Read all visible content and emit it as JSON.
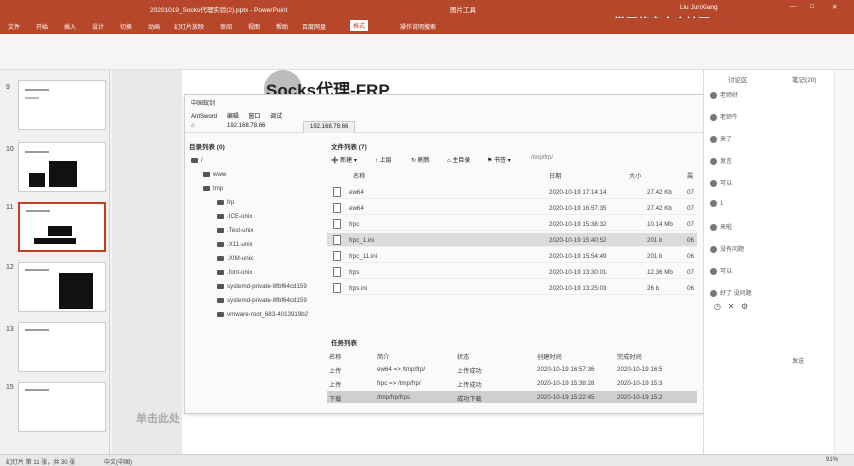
{
  "app": {
    "doc_title": "20201019_Socks代理实验(2).pptx  -  PowerPoint",
    "context_tab": "图片工具",
    "user": "Liu JunXiang",
    "watermark": "微网络安全合社区 Llll"
  },
  "ribbon": {
    "tabs": [
      "文件",
      "开始",
      "插入",
      "设计",
      "切换",
      "动画",
      "幻灯片放映",
      "审阅",
      "视图",
      "帮助",
      "百度网盘",
      "格式",
      "操作说明搜索"
    ],
    "active": "格式"
  },
  "slides": [
    {
      "num": "9"
    },
    {
      "num": "10"
    },
    {
      "num": "11"
    },
    {
      "num": "12"
    },
    {
      "num": "13"
    },
    {
      "num": "15"
    }
  ],
  "slide": {
    "title": "Socks代理-FRP",
    "click_hint": "单击此处"
  },
  "antsword": {
    "window_title": "中国蚁剑",
    "menu": [
      "AntSword",
      "编辑",
      "窗口",
      "调试"
    ],
    "tabs": [
      "192.168.78.66",
      "192.168.78.66"
    ],
    "dir_panel": "目录列表 (0)",
    "file_panel": "文件列表 (7)",
    "tree": [
      {
        "label": "/",
        "depth": 0
      },
      {
        "label": "www",
        "depth": 1
      },
      {
        "label": "tmp",
        "depth": 1
      },
      {
        "label": "frp",
        "depth": 2
      },
      {
        "label": ".ICE-unix",
        "depth": 2
      },
      {
        "label": ".Test-unix",
        "depth": 2
      },
      {
        "label": ".X11-unix",
        "depth": 2
      },
      {
        "label": ".XIM-unix",
        "depth": 2
      },
      {
        "label": ".font-unix",
        "depth": 2
      },
      {
        "label": "systemd-private-8fbf64cd159",
        "depth": 2
      },
      {
        "label": "systemd-private-8fbf64cd159",
        "depth": 2
      },
      {
        "label": "vmware-root_683-4013919b2",
        "depth": 2
      }
    ],
    "toolbar": [
      "新建",
      "上层",
      "刷新",
      "主目录",
      "书签",
      "/tmp/frp/"
    ],
    "file_headers": [
      "名称",
      "日期",
      "大小",
      "属"
    ],
    "files": [
      {
        "name": "ew64",
        "date": "2020-10-19 17:14:14",
        "size": "27.42 Kb",
        "perm": "07"
      },
      {
        "name": "ew64",
        "date": "2020-10-19 16:57:35",
        "size": "27.42 Kb",
        "perm": "07"
      },
      {
        "name": "frpc",
        "date": "2020-10-19 15:38:32",
        "size": "10.14 Mb",
        "perm": "07"
      },
      {
        "name": "frpc_1.ini",
        "date": "2020-10-19 15:40:52",
        "size": "201 b",
        "perm": "06",
        "highlight": true
      },
      {
        "name": "frpc_11.ini",
        "date": "2020-10-19 15:54:49",
        "size": "201 b",
        "perm": "06"
      },
      {
        "name": "frps",
        "date": "2020-10-19 13:30:01",
        "size": "12.36 Mb",
        "perm": "07"
      },
      {
        "name": "frps.ini",
        "date": "2020-10-19 13:25:03",
        "size": "26 b",
        "perm": "06"
      }
    ],
    "task_panel": "任务列表",
    "task_headers": [
      "名称",
      "简介",
      "状态",
      "创建时间",
      "完成时间"
    ],
    "tasks": [
      {
        "name": "上传",
        "desc": "ew64 => /tmp/frp/",
        "status": "上传成功",
        "created": "2020-10-19 16:57:36",
        "done": "2020-10-19 16:5"
      },
      {
        "name": "上传",
        "desc": "frpc => /tmp/frp/",
        "status": "上传成功",
        "created": "2020-10-19 15:38:28",
        "done": "2020-10-19 15:3"
      },
      {
        "name": "下载",
        "desc": "/tmp/frp/frps",
        "status": "成功下载",
        "created": "2020-10-19 15:22:45",
        "done": "2020-10-19 15:2",
        "highlight": true
      }
    ]
  },
  "chat": {
    "tabs": [
      "讨论区",
      "笔记(20)"
    ],
    "items": [
      "老师好",
      "老师牛",
      "来了",
      "发言",
      "可以",
      "1",
      "来啦",
      "没有问题",
      "可以",
      "好了 没问题"
    ],
    "footer": "发送"
  },
  "status": {
    "slide_info": "幻灯片 第 11 张，共 30 张",
    "lang": "中文(中国)",
    "zoom": "91%"
  }
}
